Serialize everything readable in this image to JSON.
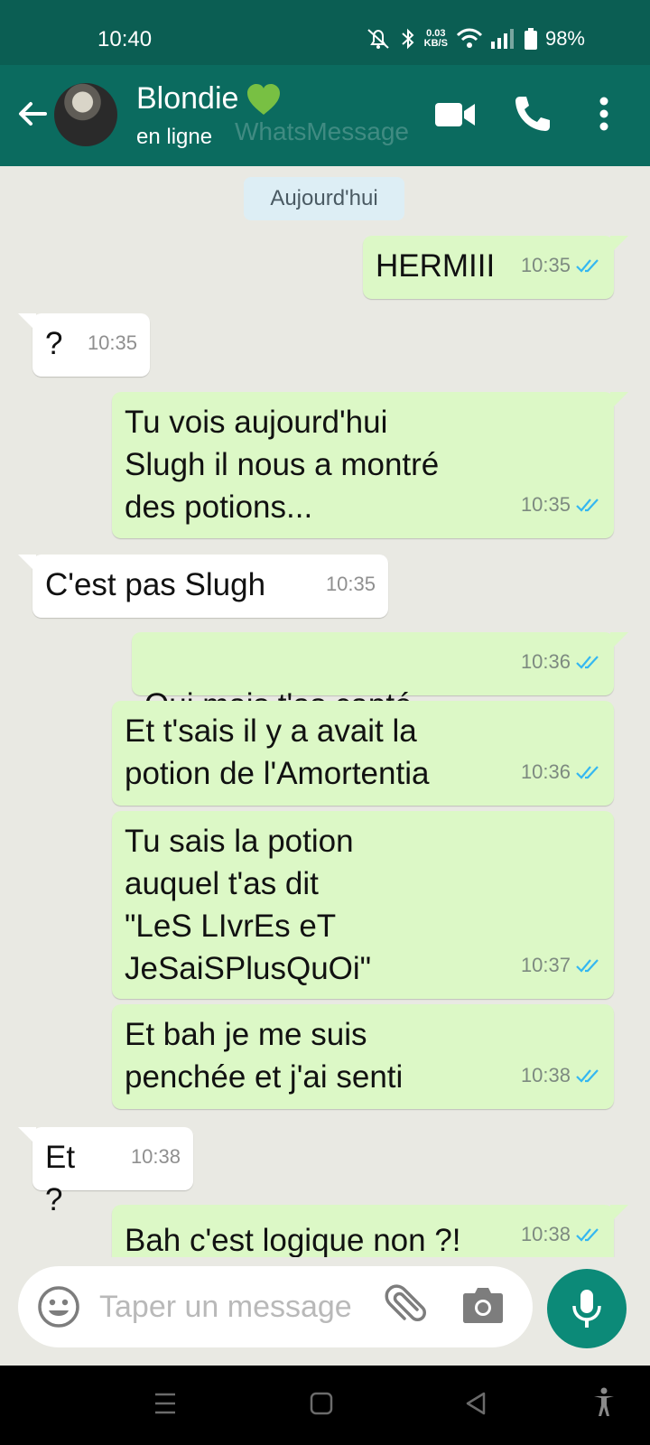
{
  "status_bar": {
    "time": "10:40",
    "speed_value": "0.03",
    "speed_unit": "KB/S",
    "battery": "98%"
  },
  "header": {
    "contact_name": "Blondie",
    "status": "en ligne",
    "watermark": "WhatsMessage",
    "icons": [
      "back-arrow-icon",
      "video-call-icon",
      "voice-call-icon",
      "more-vert-icon"
    ]
  },
  "chat": {
    "date_chip": "Aujourd'hui",
    "messages": [
      {
        "dir": "out",
        "text": "HERMIII",
        "time": "10:35",
        "read": true
      },
      {
        "dir": "in",
        "text": "?",
        "time": "10:35"
      },
      {
        "dir": "out",
        "text": "Tu vois aujourd'hui\nSlugh il nous a montré\ndes potions...",
        "time": "10:35",
        "read": true
      },
      {
        "dir": "in",
        "text": "C'est pas Slugh",
        "time": "10:35"
      },
      {
        "dir": "out",
        "text": "Oui mais t'as capté",
        "emoji": "face-with-rolling-eyes",
        "time": "10:36",
        "read": true
      },
      {
        "dir": "out",
        "text": "Et t'sais il y a avait la\npotion de l'Amortentia",
        "time": "10:36",
        "read": true
      },
      {
        "dir": "out",
        "text": "Tu sais la potion\nauquel t'as dit\n\"LeS LIvrEs eT\nJeSaiSPlusQuOi\"",
        "time": "10:37",
        "read": true
      },
      {
        "dir": "out",
        "text": "Et bah je me suis\npenchée et j'ai senti",
        "time": "10:38",
        "read": true
      },
      {
        "dir": "in",
        "text": "Et ?",
        "time": "10:38"
      },
      {
        "dir": "out",
        "text": "Bah c'est logique non ?!",
        "time": "10:38",
        "read": true
      }
    ]
  },
  "input_bar": {
    "placeholder": "Taper un message",
    "icons": [
      "emoji-icon",
      "attach-icon",
      "camera-icon",
      "mic-icon"
    ]
  },
  "colors": {
    "status_bar": "#0b5e53",
    "header": "#0b6b5f",
    "outgoing_bubble": "#dcf8c6",
    "incoming_bubble": "#ffffff",
    "chat_background": "#e9e9e3",
    "read_ticks": "#34b7f1",
    "mic_button": "#0c8a78"
  }
}
